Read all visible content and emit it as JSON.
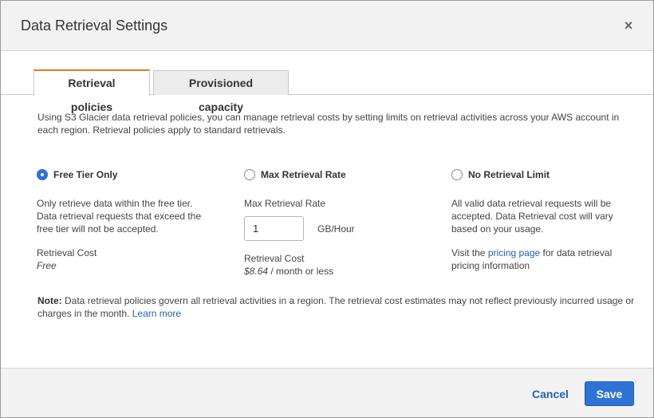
{
  "dialog": {
    "title": "Data Retrieval Settings",
    "close_glyph": "×"
  },
  "tabs": [
    {
      "label": "Retrieval policies",
      "active": true
    },
    {
      "label": "Provisioned capacity",
      "active": false
    }
  ],
  "intro": "Using S3 Glacier data retrieval policies, you can manage retrieval costs by setting limits on retrieval activities across your AWS account in each region. Retrieval policies apply to standard retrievals.",
  "options": {
    "free_tier": {
      "label": "Free Tier Only",
      "selected": true,
      "description": "Only retrieve data within the free tier. Data retrieval requests that exceed the free tier will not be accepted.",
      "cost_label": "Retrieval Cost",
      "cost_value": "Free"
    },
    "max_rate": {
      "label": "Max Retrieval Rate",
      "selected": false,
      "field_label": "Max Retrieval Rate",
      "field_value": "1",
      "unit": "GB/Hour",
      "cost_label": "Retrieval Cost",
      "cost_value": "$8.64",
      "cost_suffix": " / month or less"
    },
    "no_limit": {
      "label": "No Retrieval Limit",
      "selected": false,
      "description": "All valid data retrieval requests will be accepted. Data Retrieval cost will vary based on your usage.",
      "visit_prefix": "Visit the ",
      "pricing_link": "pricing page",
      "visit_suffix": " for data retrieval pricing information"
    }
  },
  "note": {
    "label": "Note:",
    "text": " Data retrieval policies govern all retrieval activities in a region. The retrieval cost estimates may not reflect previously incurred usage or charges in the month. ",
    "learn_more": "Learn more"
  },
  "footer": {
    "cancel_label": "Cancel",
    "save_label": "Save"
  },
  "colors": {
    "accent": "#2e73d6",
    "link": "#1f62b8",
    "tab_highlight": "#e07b24"
  }
}
